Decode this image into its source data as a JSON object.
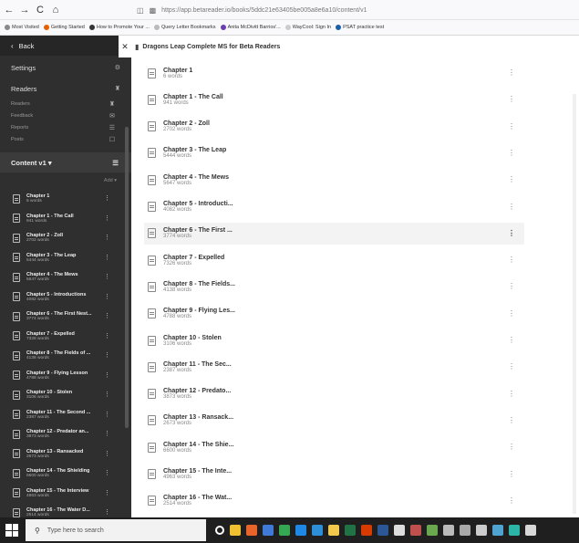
{
  "browser": {
    "url": "https://app.betareader.io/books/5ddc21e63405be005a8e6a10/content/v1",
    "nav": {
      "back": "←",
      "forward": "→",
      "reload": "C",
      "home": "⌂"
    },
    "bookmarks": [
      {
        "label": "Most Visited",
        "color": "#888"
      },
      {
        "label": "Getting Started",
        "color": "#e66000"
      },
      {
        "label": "How to Promote Your ...",
        "color": "#333"
      },
      {
        "label": "Query Letter Bookmarks",
        "color": "#bbb"
      },
      {
        "label": "Anita McDivitt Barrios'...",
        "color": "#6b3fb0"
      },
      {
        "label": "WayCool: Sign In",
        "color": "#ccc"
      },
      {
        "label": "PSAT practice test",
        "color": "#1a5fa8"
      }
    ]
  },
  "sidebar": {
    "back_label": "Back",
    "settings_label": "Settings",
    "readers_label": "Readers",
    "reader_sub": [
      "Readers",
      "Feedback",
      "Reports",
      "Posts"
    ],
    "content_label": "Content v1 ▾",
    "add_label": "Add ▾",
    "items": [
      {
        "title": "Chapter 1",
        "words": "6 words"
      },
      {
        "title": "Chapter 1 - The Call",
        "words": "941 words"
      },
      {
        "title": "Chapter 2 - Zoll",
        "words": "2702 words"
      },
      {
        "title": "Chapter 3 - The Leap",
        "words": "5444 words"
      },
      {
        "title": "Chapter 4 - The Mews",
        "words": "5647 words"
      },
      {
        "title": "Chapter 5 - Introductions",
        "words": "4082 words"
      },
      {
        "title": "Chapter 6 - The First Nest...",
        "words": "3774 words"
      },
      {
        "title": "Chapter 7 - Expelled",
        "words": "7328 words"
      },
      {
        "title": "Chapter 8 - The Fields of ...",
        "words": "4138 words"
      },
      {
        "title": "Chapter 9 - Flying Lesson",
        "words": "4788 words"
      },
      {
        "title": "Chapter 10 - Stolen",
        "words": "3106 words"
      },
      {
        "title": "Chapter 11 - The Second ...",
        "words": "2387 words"
      },
      {
        "title": "Chapter 12 - Predator an...",
        "words": "3873 words"
      },
      {
        "title": "Chapter 13 - Ransacked",
        "words": "2673 words"
      },
      {
        "title": "Chapter 14 - The Shielding",
        "words": "6600 words"
      },
      {
        "title": "Chapter 15 - The Interview",
        "words": "4963 words"
      },
      {
        "title": "Chapter 16 - The Water D...",
        "words": "2514 words"
      }
    ]
  },
  "header": {
    "close_glyph": "✕",
    "book_title": "Dragons Leap Complete MS for Beta Readers"
  },
  "main": {
    "items": [
      {
        "title": "Chapter 1",
        "words": "6 words"
      },
      {
        "title": "Chapter 1 - The Call",
        "words": "941 words"
      },
      {
        "title": "Chapter 2 - Zoll",
        "words": "2702 words"
      },
      {
        "title": "Chapter 3 - The Leap",
        "words": "5444 words"
      },
      {
        "title": "Chapter 4 - The Mews",
        "words": "5647 words"
      },
      {
        "title": "Chapter 5 - Introducti...",
        "words": "4082 words"
      },
      {
        "title": "Chapter 6 - The First ...",
        "words": "3774 words"
      },
      {
        "title": "Chapter 7 - Expelled",
        "words": "7326 words"
      },
      {
        "title": "Chapter 8 - The Fields...",
        "words": "4138 words"
      },
      {
        "title": "Chapter 9 - Flying Les...",
        "words": "4788 words"
      },
      {
        "title": "Chapter 10 - Stolen",
        "words": "3106 words"
      },
      {
        "title": "Chapter 11 - The Sec...",
        "words": "2387 words"
      },
      {
        "title": "Chapter 12 - Predato...",
        "words": "3873 words"
      },
      {
        "title": "Chapter 13 - Ransack...",
        "words": "2673 words"
      },
      {
        "title": "Chapter 14 - The Shie...",
        "words": "6600 words"
      },
      {
        "title": "Chapter 15 - The Inte...",
        "words": "4963 words"
      },
      {
        "title": "Chapter 16 - The Wat...",
        "words": "2514 words"
      }
    ],
    "highlighted_index": 6
  },
  "taskbar": {
    "search_placeholder": "Type here to search",
    "icons": [
      {
        "name": "task-view-icon",
        "color": "#ffffff"
      },
      {
        "name": "file-explorer-icon",
        "color": "#f0c030"
      },
      {
        "name": "firefox-icon",
        "color": "#e8642a"
      },
      {
        "name": "mail-icon",
        "color": "#3f7ad8"
      },
      {
        "name": "chrome-icon",
        "color": "#34a853"
      },
      {
        "name": "edge-icon",
        "color": "#1e88e5"
      },
      {
        "name": "ie-icon",
        "color": "#2d8fd8"
      },
      {
        "name": "store-icon",
        "color": "#f2c94c"
      },
      {
        "name": "excel-icon",
        "color": "#217346"
      },
      {
        "name": "office-icon",
        "color": "#d83b01"
      },
      {
        "name": "word-icon",
        "color": "#2b5797"
      },
      {
        "name": "snip-icon",
        "color": "#dddddd"
      },
      {
        "name": "photos-icon",
        "color": "#c0504d"
      },
      {
        "name": "app-icon-a",
        "color": "#6aa84f"
      },
      {
        "name": "app-icon-b",
        "color": "#bbbbbb"
      },
      {
        "name": "app-icon-c",
        "color": "#aaaaaa"
      },
      {
        "name": "app-icon-d",
        "color": "#cccccc"
      },
      {
        "name": "app-icon-e",
        "color": "#4fa3d1"
      },
      {
        "name": "app-icon-f",
        "color": "#2bb6a8"
      },
      {
        "name": "app-icon-g",
        "color": "#d8d8d8"
      }
    ]
  }
}
